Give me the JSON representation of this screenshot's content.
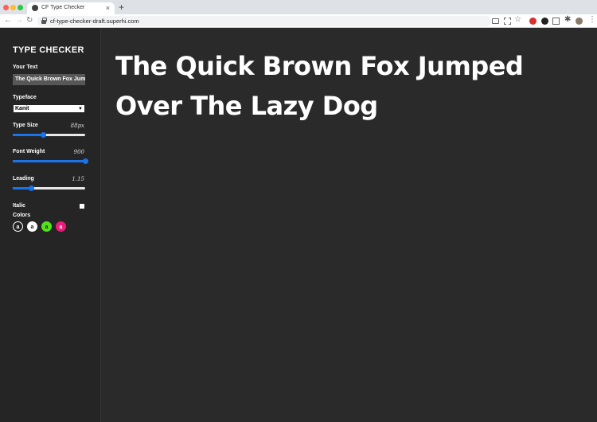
{
  "browser": {
    "tab_title": "CF Type Checker",
    "tab_close": "×",
    "new_tab": "+",
    "url": "cf-type-checker-draft.superhi.com",
    "back": "←",
    "forward": "→",
    "reload": "↻",
    "star": "☆",
    "puzzle": "✱",
    "menu": "⋮"
  },
  "sidebar": {
    "title": "TYPE CHECKER",
    "your_text_label": "Your Text",
    "your_text_value": "The Quick Brown Fox Jumped Over The Lazy Dog",
    "typeface_label": "Typeface",
    "typeface_value": "Kanit",
    "type_size_label": "Type Size",
    "type_size_value": "88px",
    "type_size_fraction": 0.42,
    "font_weight_label": "Font Weight",
    "font_weight_value": "900",
    "font_weight_fraction": 1.0,
    "leading_label": "Leading",
    "leading_value": "1.15",
    "leading_fraction": 0.25,
    "italic_label": "Italic",
    "italic_checked": false,
    "colors_label": "Colors",
    "swatches": [
      {
        "letter": "a",
        "bg": "#252525",
        "fg": "#ffffff",
        "border": "#ffffff"
      },
      {
        "letter": "a",
        "bg": "#ffffff",
        "fg": "#252525",
        "border": "#ffffff"
      },
      {
        "letter": "a",
        "bg": "#52e21c",
        "fg": "#252525",
        "border": "#52e21c"
      },
      {
        "letter": "a",
        "bg": "#ec1c7a",
        "fg": "#ffffff",
        "border": "#ec1c7a"
      }
    ]
  },
  "preview": {
    "text": "The Quick Brown Fox Jumped Over The Lazy Dog"
  },
  "colors": {
    "accent": "#1a73e8",
    "page_bg": "#2a2a2a",
    "sidebar_bg": "#252525"
  }
}
